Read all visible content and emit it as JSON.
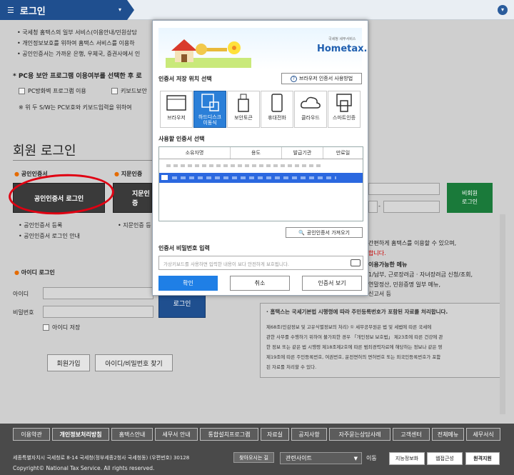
{
  "header": {
    "title": "로그인",
    "menu_icon": "hamburger-icon",
    "arrow": "▾",
    "right_chevron": "▾"
  },
  "notices": [
    "• 국세청 홈택스의 일부 서비스(이용안내/민원상담",
    "• 개인정보보호를 위하여 홈택스 서비스를 이용하",
    "• 공인인증서는 가까운 은행, 우체국, 증권사에서 인"
  ],
  "security": {
    "heading": "* PC용 보안 프로그램 이용여부를 선택한 후 로",
    "opt1": "PC방화벽 프로그램 이용",
    "opt2": "키보드보안",
    "note": "※ 위 두 S/W는 PC보호와 키보드입력을 위하여"
  },
  "member_login": {
    "title": "회원 로그인",
    "cert_section": "공인인증서",
    "cert_button": "공인인증서 로그인",
    "finger_section": "지문인증",
    "finger_button": "지문인증",
    "cert_links": [
      "• 공인인증서 등록",
      "• 공인인증서 로그인 안내"
    ],
    "finger_link": "• 지문인증 등",
    "id_section": "아이디 로그인",
    "id_label": "아이디",
    "pw_label": "비밀번호",
    "login_button": "로그인",
    "save_id": "아이디 저장",
    "join_button": "회원가입",
    "find_button": "아이디/비밀번호 찾기"
  },
  "non_member": {
    "button": "비회원\n로그인",
    "text1": "간편하게 홈택스를 이용할 수 있으며,",
    "text2": "합니다.",
    "menu_title": "이용가능한 메뉴",
    "menu1": "1/납부, 근로장려금 · 자녀장려금 신청/조회,",
    "menu2": "연말정산, 민원증명 일부 메뉴,",
    "menu3": "신고서 등"
  },
  "privacy": {
    "bold": "· 홈택스는 국세기본법 시행령에 따라 주민등록번호가 포함된 자료를 처리합니다.",
    "lines": [
      "제68조(민감정보 및 고유식별정보의 처리) ① 세무공무원은 법 및 세법에 따른 국세에",
      "관한 사무를 수행하기 위하여 불가피한 경우 「개인정보 보호법」 제23조에 따른 건강에 관",
      "한 정보 또는 같은 법 시행령 제18조제2호에 따른 범죄경력자료에 해당하는 정보나 같은 영",
      "제19조에 따른 주민등록번호, 여권번호, 운전면허의 면허번호 또는 외국인등록번호가 포함",
      "된 자료를 처리할 수 있다."
    ]
  },
  "modal": {
    "logo": "Hometax.",
    "logo_sub": "국세청 세무서비스",
    "location_label": "인증서 저장 위치 선택",
    "help_button": "브라우저 인증서 사용방법",
    "devices": [
      "브라우저",
      "하드디스크\n이동식",
      "보안토큰",
      "휴대전화",
      "클라우드",
      "스마트인증"
    ],
    "cert_label": "사용할 인증서 선택",
    "columns": [
      "소유자명",
      "용도",
      "발급기관",
      "만료일"
    ],
    "import_button": "공인인증서 가져오기",
    "pw_label": "인증서 비밀번호 입력",
    "pw_placeholder": "가상키보드를 사용하면 입력한 내용이 보다 안전하게 보호됩니다.",
    "ok": "확인",
    "cancel": "취소",
    "view": "인증서 보기"
  },
  "footer": {
    "nav": [
      "이용약관",
      "개인정보처리방침",
      "홈택스안내",
      "세무서 안내",
      "통합설치프로그램",
      "자료실",
      "공지사항",
      "자주묻는상담사례",
      "고객센터",
      "전체메뉴",
      "세무서식"
    ],
    "address": "세종특별자치시 국세청로 8-14 국세청(정부세종2청사 국세청동) (우편번호) 30128",
    "directions": "찾아오시는 길",
    "related": "관련사이트",
    "go": "이동",
    "copyright": "Copyright© National Tax Service. All rights reserved.",
    "badges": [
      "지능정보화",
      "웹접근성",
      "원격지원"
    ]
  },
  "colors": {
    "accent": "#1f4f8f",
    "highlight": "#e00012",
    "selected": "#2b7fd8",
    "green": "#1a7a3a"
  }
}
